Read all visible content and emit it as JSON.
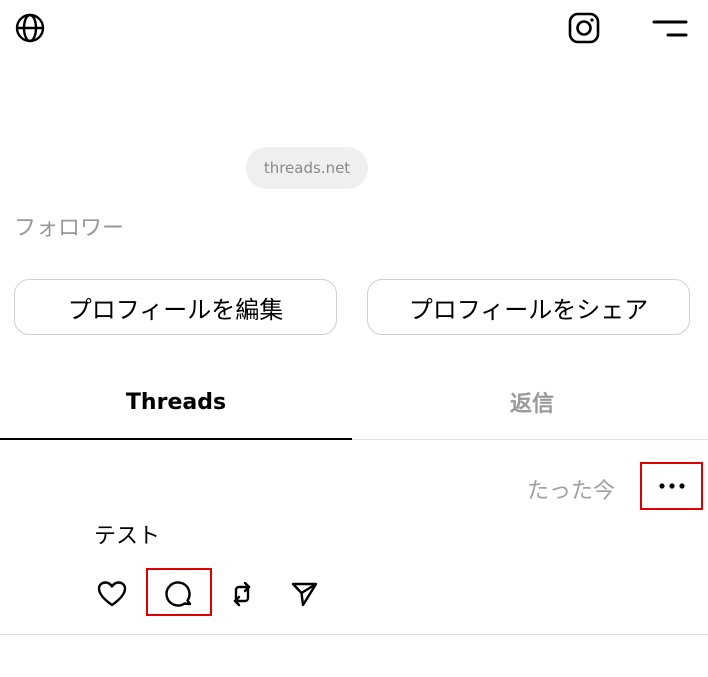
{
  "header": {
    "globe_icon": "globe-icon",
    "instagram_icon": "instagram-icon",
    "menu_icon": "menu-icon"
  },
  "profile": {
    "domain_pill": "threads.net",
    "followers_label": "フォロワー",
    "edit_profile_label": "プロフィールを編集",
    "share_profile_label": "プロフィールをシェア"
  },
  "tabs": [
    {
      "label": "Threads",
      "active": true
    },
    {
      "label": "返信",
      "active": false
    }
  ],
  "post": {
    "timestamp": "たった今",
    "more_icon": "more-icon",
    "text": "テスト",
    "actions": [
      "heart-icon",
      "reply-icon",
      "repost-icon",
      "share-icon"
    ]
  },
  "highlight_color": "#e00000"
}
